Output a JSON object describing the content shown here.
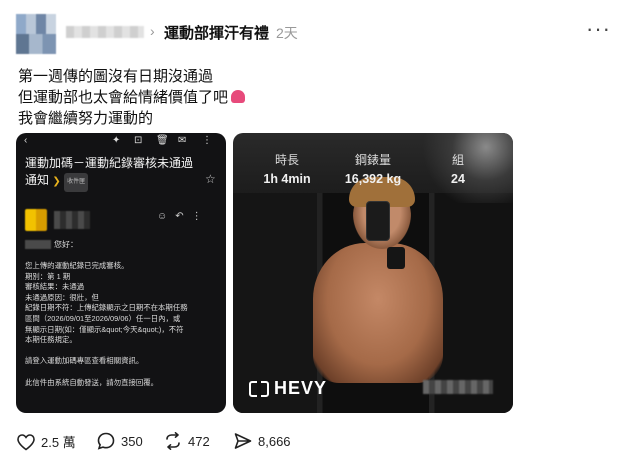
{
  "header": {
    "topic": "運動部揮汗有禮",
    "time": "2天",
    "more_icon": "ellipsis-icon"
  },
  "body_text": [
    "第一週傳的圖沒有日期沒通過",
    "但運動部也太會給情緒價值了吧",
    "我會繼續努力運動的"
  ],
  "email_image": {
    "subject_line1": "運動加碼－運動紀錄審核未通過",
    "subject_line2": "通知",
    "badge": "收件匣",
    "greeting": "您好：",
    "body_lines": [
      "您上傳的運動紀錄已完成審核。",
      "期別：第 1 期",
      "審核結果：未通過",
      "未通過原因：很壯，但",
      "紀錄日期不符：上傳紀錄顯示之日期不在本期任務",
      "區間（2026/09/01至2026/09/06）任一日內，或",
      "無顯示日期(如：僅顯示&quot;今天&quot;)，不符",
      "本期任務規定。"
    ],
    "body_lines_2": [
      "請登入運動加碼專區查看相關資訊。"
    ],
    "body_lines_3": [
      "此信件由系統自動發送，請勿直接回覆。"
    ]
  },
  "gym_image": {
    "stats": [
      {
        "label": "時長",
        "value": "1h 4min"
      },
      {
        "label": "鋼錶量",
        "value": "16,392 kg"
      },
      {
        "label": "組",
        "value": "24"
      }
    ],
    "brand": "HEVY"
  },
  "actions": {
    "likes": "2.5 萬",
    "comments": "350",
    "reposts": "472",
    "shares": "8,666"
  }
}
